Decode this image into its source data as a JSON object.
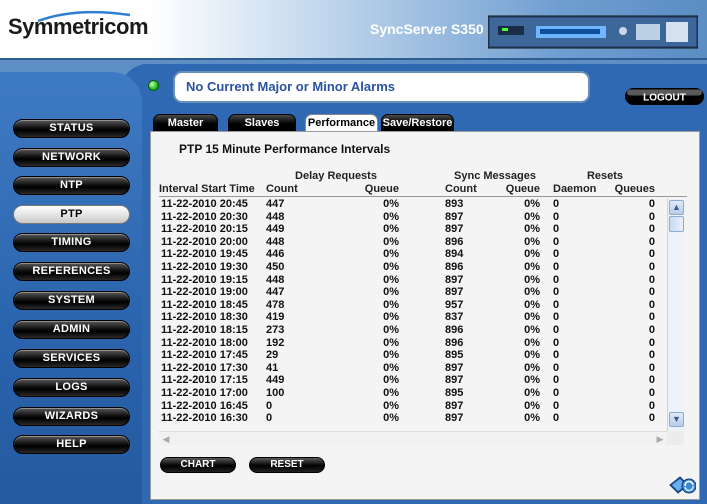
{
  "header": {
    "logo": "Symmetricom",
    "product": "SyncServer S350"
  },
  "alarm": {
    "text": "No Current Major or Minor Alarms",
    "led_color": "#1fc21a"
  },
  "logout_label": "LOGOUT",
  "nav": {
    "items": [
      "STATUS",
      "NETWORK",
      "NTP",
      "PTP",
      "TIMING",
      "REFERENCES",
      "SYSTEM",
      "ADMIN",
      "SERVICES",
      "LOGS",
      "WIZARDS",
      "HELP"
    ],
    "active": "PTP"
  },
  "tabs": [
    "Master",
    "Slaves",
    "Performance",
    "Save/Restore"
  ],
  "active_tab": "Performance",
  "panel": {
    "title": "PTP 15 Minute Performance Intervals"
  },
  "table": {
    "groups": {
      "delay": "Delay Requests",
      "sync": "Sync Messages",
      "resets": "Resets"
    },
    "columns": {
      "time": "Interval Start Time",
      "dcount": "Count",
      "dqueue": "Queue",
      "scount": "Count",
      "squeue": "Queue",
      "daemon": "Daemon",
      "queues": "Queues"
    },
    "rows": [
      [
        "11-22-2010 20:45",
        "447",
        "0%",
        "893",
        "0%",
        "0",
        "0"
      ],
      [
        "11-22-2010 20:30",
        "448",
        "0%",
        "897",
        "0%",
        "0",
        "0"
      ],
      [
        "11-22-2010 20:15",
        "449",
        "0%",
        "897",
        "0%",
        "0",
        "0"
      ],
      [
        "11-22-2010 20:00",
        "448",
        "0%",
        "896",
        "0%",
        "0",
        "0"
      ],
      [
        "11-22-2010 19:45",
        "446",
        "0%",
        "894",
        "0%",
        "0",
        "0"
      ],
      [
        "11-22-2010 19:30",
        "450",
        "0%",
        "896",
        "0%",
        "0",
        "0"
      ],
      [
        "11-22-2010 19:15",
        "448",
        "0%",
        "897",
        "0%",
        "0",
        "0"
      ],
      [
        "11-22-2010 19:00",
        "447",
        "0%",
        "897",
        "0%",
        "0",
        "0"
      ],
      [
        "11-22-2010 18:45",
        "478",
        "0%",
        "957",
        "0%",
        "0",
        "0"
      ],
      [
        "11-22-2010 18:30",
        "419",
        "0%",
        "837",
        "0%",
        "0",
        "0"
      ],
      [
        "11-22-2010 18:15",
        "273",
        "0%",
        "896",
        "0%",
        "0",
        "0"
      ],
      [
        "11-22-2010 18:00",
        "192",
        "0%",
        "896",
        "0%",
        "0",
        "0"
      ],
      [
        "11-22-2010 17:45",
        "29",
        "0%",
        "895",
        "0%",
        "0",
        "0"
      ],
      [
        "11-22-2010 17:30",
        "41",
        "0%",
        "897",
        "0%",
        "0",
        "0"
      ],
      [
        "11-22-2010 17:15",
        "449",
        "0%",
        "897",
        "0%",
        "0",
        "0"
      ],
      [
        "11-22-2010 17:00",
        "100",
        "0%",
        "895",
        "0%",
        "0",
        "0"
      ],
      [
        "11-22-2010 16:45",
        "0",
        "0%",
        "897",
        "0%",
        "0",
        "0"
      ],
      [
        "11-22-2010 16:30",
        "0",
        "0%",
        "897",
        "0%",
        "0",
        "0"
      ]
    ]
  },
  "buttons": {
    "chart": "CHART",
    "reset": "RESET"
  }
}
